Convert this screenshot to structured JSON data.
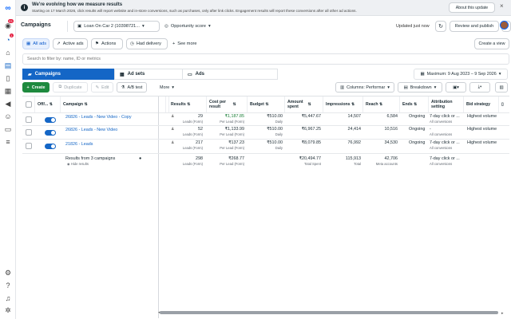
{
  "notice": {
    "title": "We're evolving how we measure results",
    "body": "Starting on 17 March 2026, click results will report website and in-store conversions, such as purchases, only after link clicks. Engagement results will report these conversions after all other ad actions.",
    "about_label": "About this update"
  },
  "rail": {
    "notification_count": "23",
    "alerts_count": "1"
  },
  "header": {
    "title": "Campaigns",
    "account": "Loan On Car 2 (10398721...",
    "opportunity": "Opportunity score",
    "updated": "Updated just now",
    "review_label": "Review and publish",
    "more_label": "···"
  },
  "chips": [
    {
      "label": "All ads",
      "icon": "grid-icon"
    },
    {
      "label": "Active ads",
      "icon": "active-icon"
    },
    {
      "label": "Actions",
      "icon": "actions-icon"
    },
    {
      "label": "Had delivery",
      "icon": "delivery-icon"
    },
    {
      "label": "See more",
      "icon": "plus-icon"
    }
  ],
  "create_view_label": "Create a view",
  "search": {
    "placeholder": "Search to filter by: name, ID or metrics"
  },
  "tabs": [
    {
      "label": "Campaigns"
    },
    {
      "label": "Ad sets"
    },
    {
      "label": "Ads"
    }
  ],
  "date_range": "Maximum: 9 Aug 2023 – 9 Sep 2026",
  "toolbar": {
    "create": "Create",
    "duplicate": "Duplicate",
    "edit": "Edit",
    "ab_test": "A/B test",
    "more": "More",
    "columns": "Columns: Performar",
    "breakdown": "Breakdown"
  },
  "columns": {
    "off_on": "Off/...",
    "campaign": "Campaign",
    "results": "Results",
    "cost_per_result": "Cost per result",
    "budget": "Budget",
    "amount_spent": "Amount spent",
    "impressions": "Impressions",
    "reach": "Reach",
    "ends": "Ends",
    "attribution": "Attribution setting",
    "bid_strategy": "Bid strategy"
  },
  "rows": [
    {
      "name": "26826 - Leads - New Video - Copy",
      "results": "29",
      "results_sub": "Leads (Form)",
      "cost": "₹1,187.85",
      "cost_sub": "Per Lead (Form)",
      "budget": "₹510.00",
      "budget_sub": "Daily",
      "spent": "₹5,447.67",
      "impressions": "14,507",
      "reach": "6,584",
      "ends": "Ongoing",
      "attribution": "7-day click or ...",
      "attribution_sub": "All conversions",
      "bid": "Highest volume",
      "on": true
    },
    {
      "name": "26826 - Leads - New Video",
      "results": "52",
      "results_sub": "Leads (Form)",
      "cost": "₹1,133.99",
      "cost_sub": "Per Lead (Form)",
      "budget": "₹510.00",
      "budget_sub": "Daily",
      "spent": "₹6,967.25",
      "impressions": "24,414",
      "reach": "10,516",
      "ends": "Ongoing",
      "attribution": "-",
      "attribution_sub": "All conversions",
      "bid": "Highest volume",
      "on": true
    },
    {
      "name": "21826 - Leads",
      "results": "217",
      "results_sub": "Leads (Form)",
      "cost": "₹137.23",
      "cost_sub": "Per Lead (Form)",
      "budget": "₹510.00",
      "budget_sub": "Daily",
      "spent": "₹8,079.85",
      "impressions": "76,992",
      "reach": "34,530",
      "ends": "Ongoing",
      "attribution": "7-day click or ...",
      "attribution_sub": "All conversions",
      "bid": "Highest volume",
      "on": true
    }
  ],
  "totals": {
    "label": "Results from 3 campaigns",
    "hide": "Hide results",
    "results": "298",
    "results_sub": "Leads (Form)",
    "cost": "₹268.77",
    "cost_sub": "Per Lead (Form)",
    "spent": "₹20,494.77",
    "spent_sub": "Total Spent",
    "impressions": "115,913",
    "impressions_sub": "Total",
    "reach": "42,706",
    "reach_sub": "Meta accounts",
    "attribution": "7-day click or ...",
    "attribution_sub": "All conversions"
  }
}
